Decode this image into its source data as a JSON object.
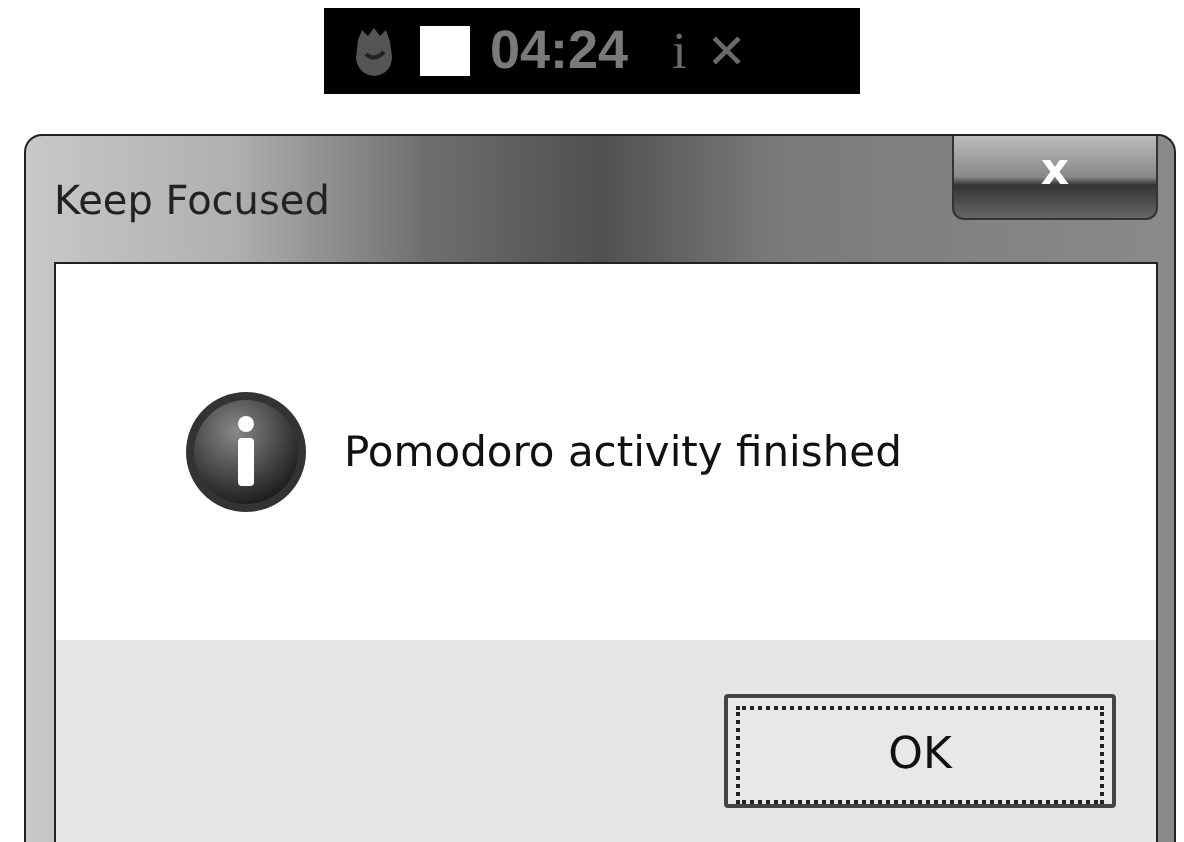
{
  "timer_bar": {
    "time": "04:24",
    "info": "i",
    "close": "✕"
  },
  "dialog": {
    "title": "Keep Focused",
    "close_label": "x",
    "message": "Pomodoro activity finished",
    "buttons": [
      {
        "label": "OK",
        "selected": true
      }
    ]
  }
}
